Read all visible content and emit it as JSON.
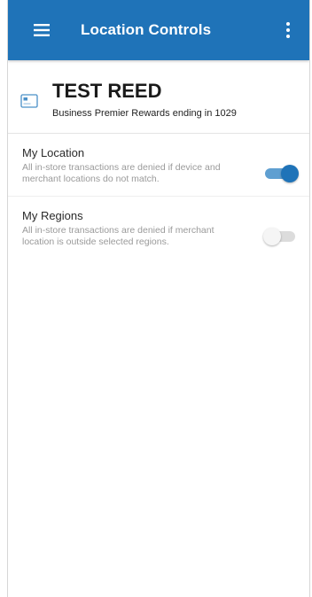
{
  "appbar": {
    "title": "Location Controls",
    "menu_icon": "hamburger-menu-icon",
    "more_icon": "more-vertical-icon",
    "color": "#1f73b8"
  },
  "card": {
    "icon": "credit-card-icon",
    "name": "TEST REED",
    "description": "Business Premier Rewards ending in 1029"
  },
  "settings": [
    {
      "title": "My Location",
      "description": "All in-store transactions are denied if device and merchant locations do not match.",
      "enabled": true
    },
    {
      "title": "My Regions",
      "description": "All in-store transactions are denied if merchant location is outside selected regions.",
      "enabled": false
    }
  ]
}
